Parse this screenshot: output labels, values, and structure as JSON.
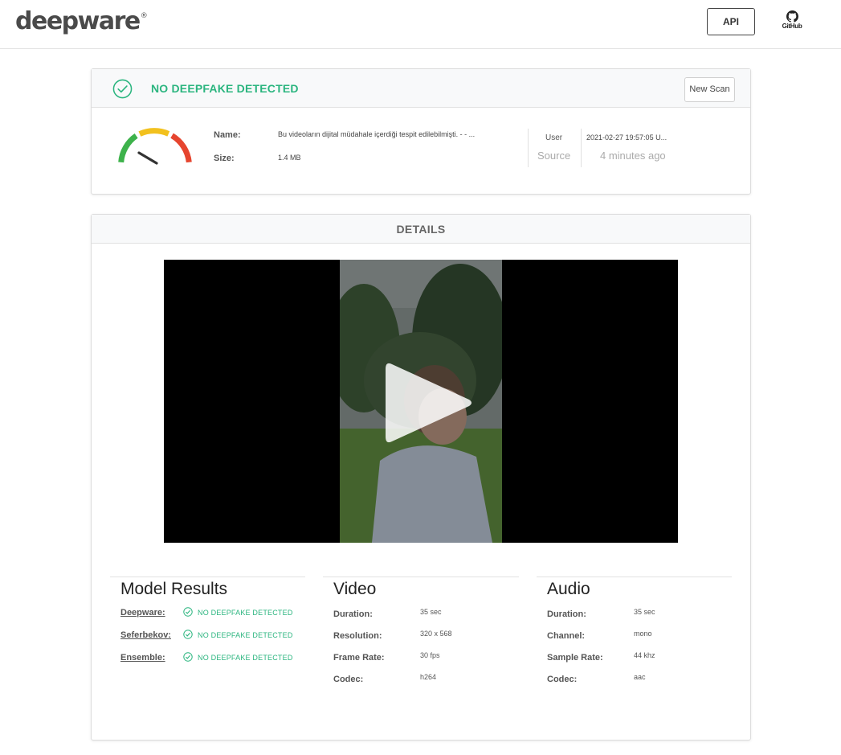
{
  "header": {
    "logo_text": "deepware",
    "logo_mark": "®",
    "api_label": "API",
    "github_label": "GitHub",
    "github_icon": "github-octocat-icon"
  },
  "result": {
    "status": "NO DEEPFAKE DETECTED",
    "status_color": "#2bb57f",
    "status_icon": "check-circle-icon",
    "new_scan_label": "New Scan",
    "gauge_icon": "gauge-meter-icon",
    "gauge_colors": [
      "#3db24b",
      "#f2c11e",
      "#e6452f"
    ],
    "name_label": "Name:",
    "name_value": "Bu videoların dijital müdahale içerdiği tespit edilebilmişti. - - ...",
    "size_label": "Size:",
    "size_value": "1.4 MB",
    "user_label": "User",
    "source_label": "Source",
    "timestamp": "2021-02-27 19:57:05 U...",
    "relative_time": "4 minutes ago"
  },
  "details": {
    "title": "DETAILS",
    "video_play_icon": "play-icon",
    "model_results": {
      "title": "Model Results",
      "items": [
        {
          "name": "Deepware:",
          "result": "NO DEEPFAKE DETECTED"
        },
        {
          "name": "Seferbekov:",
          "result": "NO DEEPFAKE DETECTED"
        },
        {
          "name": "Ensemble:",
          "result": "NO DEEPFAKE DETECTED"
        }
      ]
    },
    "video": {
      "title": "Video",
      "rows": [
        {
          "label": "Duration:",
          "value": "35 sec"
        },
        {
          "label": "Resolution:",
          "value": "320 x 568"
        },
        {
          "label": "Frame Rate:",
          "value": "30 fps"
        },
        {
          "label": "Codec:",
          "value": "h264"
        }
      ]
    },
    "audio": {
      "title": "Audio",
      "rows": [
        {
          "label": "Duration:",
          "value": "35 sec"
        },
        {
          "label": "Channel:",
          "value": "mono"
        },
        {
          "label": "Sample Rate:",
          "value": "44 khz"
        },
        {
          "label": "Codec:",
          "value": "aac"
        }
      ]
    }
  }
}
